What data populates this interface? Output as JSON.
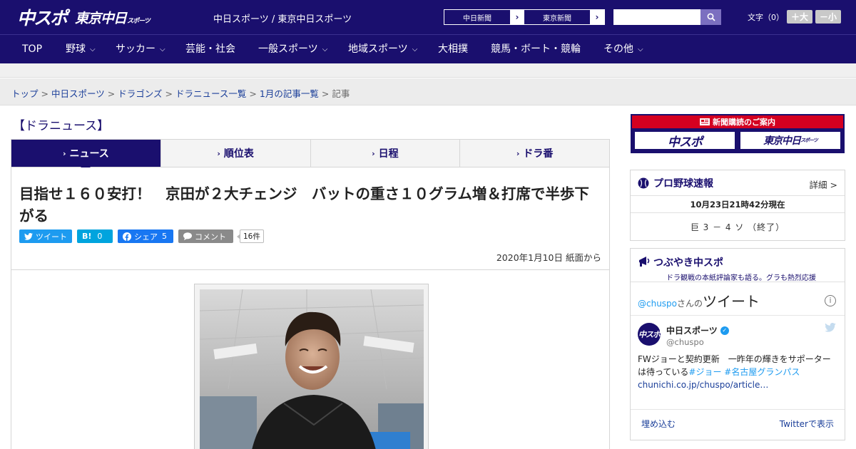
{
  "header": {
    "logo_main": "中スポ",
    "logo_tokyo": "東京中日",
    "logo_tokyo_small": "スポーツ",
    "site_names": "中日スポーツ / 東京中日スポーツ",
    "paper_buttons": [
      {
        "label": "中日新聞",
        "arrow": "›"
      },
      {
        "label": "東京新聞",
        "arrow": "›"
      }
    ],
    "search": {
      "value": "",
      "placeholder": ""
    },
    "fontsize": {
      "label": "文字（0）",
      "plus": "＋大",
      "minus": "－小"
    }
  },
  "nav": [
    {
      "label": "TOP",
      "chevron": ""
    },
    {
      "label": "野球",
      "chevron": "⌵"
    },
    {
      "label": "サッカー",
      "chevron": "⌵"
    },
    {
      "label": "芸能・社会",
      "chevron": ""
    },
    {
      "label": "一般スポーツ",
      "chevron": "⌵"
    },
    {
      "label": "地域スポーツ",
      "chevron": "⌵"
    },
    {
      "label": "大相撲",
      "chevron": ""
    },
    {
      "label": "競馬・ボート・競輪",
      "chevron": ""
    },
    {
      "label": "その他",
      "chevron": "⌵"
    }
  ],
  "breadcrumb": {
    "items": [
      "トップ",
      "中日スポーツ",
      "ドラゴンズ",
      "ドラニュース一覧",
      "1月の記事一覧"
    ],
    "current": "記事",
    "separator": ">"
  },
  "section_title": "【ドラニュース】",
  "tabs": [
    {
      "label": "ニュース",
      "active": true
    },
    {
      "label": "順位表",
      "active": false
    },
    {
      "label": "日程",
      "active": false
    },
    {
      "label": "ドラ番",
      "active": false
    }
  ],
  "article": {
    "headline": "目指せ１６０安打！　京田が２大チェンジ　バットの重さ１０グラム増＆打席で半歩下がる",
    "share": {
      "tweet": "ツイート",
      "hatena_label": "B!",
      "hatena_count": "0",
      "facebook": "シェア",
      "facebook_count": "5",
      "comment": "コメント",
      "comment_count": "16件"
    },
    "dateline": "2020年1月10日 紙面から"
  },
  "sidebar": {
    "ad": {
      "top": "新聞購読のご案内",
      "logo_a": "中スポ",
      "logo_b": "東京中日",
      "logo_b_small": "スポーツ"
    },
    "baseball": {
      "title": "プロ野球速報",
      "more": "詳細 >",
      "time": "10月23日21時42分現在",
      "score": "巨 3 － 4 ソ （終了）"
    },
    "twitter": {
      "title": "つぶやき中スポ",
      "subtitle": "ドラ観戦の本紙評論家も語る。グラも熱烈応援",
      "handle": "@chuspo",
      "handle_suffix": "さんの",
      "handle_big": "ツイート",
      "info": "i",
      "avatar": "中スポ",
      "name": "中日スポーツ",
      "verified": "✓",
      "user": "@chuspo",
      "text": "FWジョーと契約更新　一昨年の輝きをサポーターは待っている",
      "tags": "#ジョー #名古屋グランパス",
      "link": "chunichi.co.jp/chuspo/article…",
      "embed": "埋め込む",
      "view": "Twitterで表示"
    }
  },
  "colors": {
    "brand": "#1a0f6e",
    "accent_red": "#d40020",
    "twitter": "#1d9bf0"
  }
}
